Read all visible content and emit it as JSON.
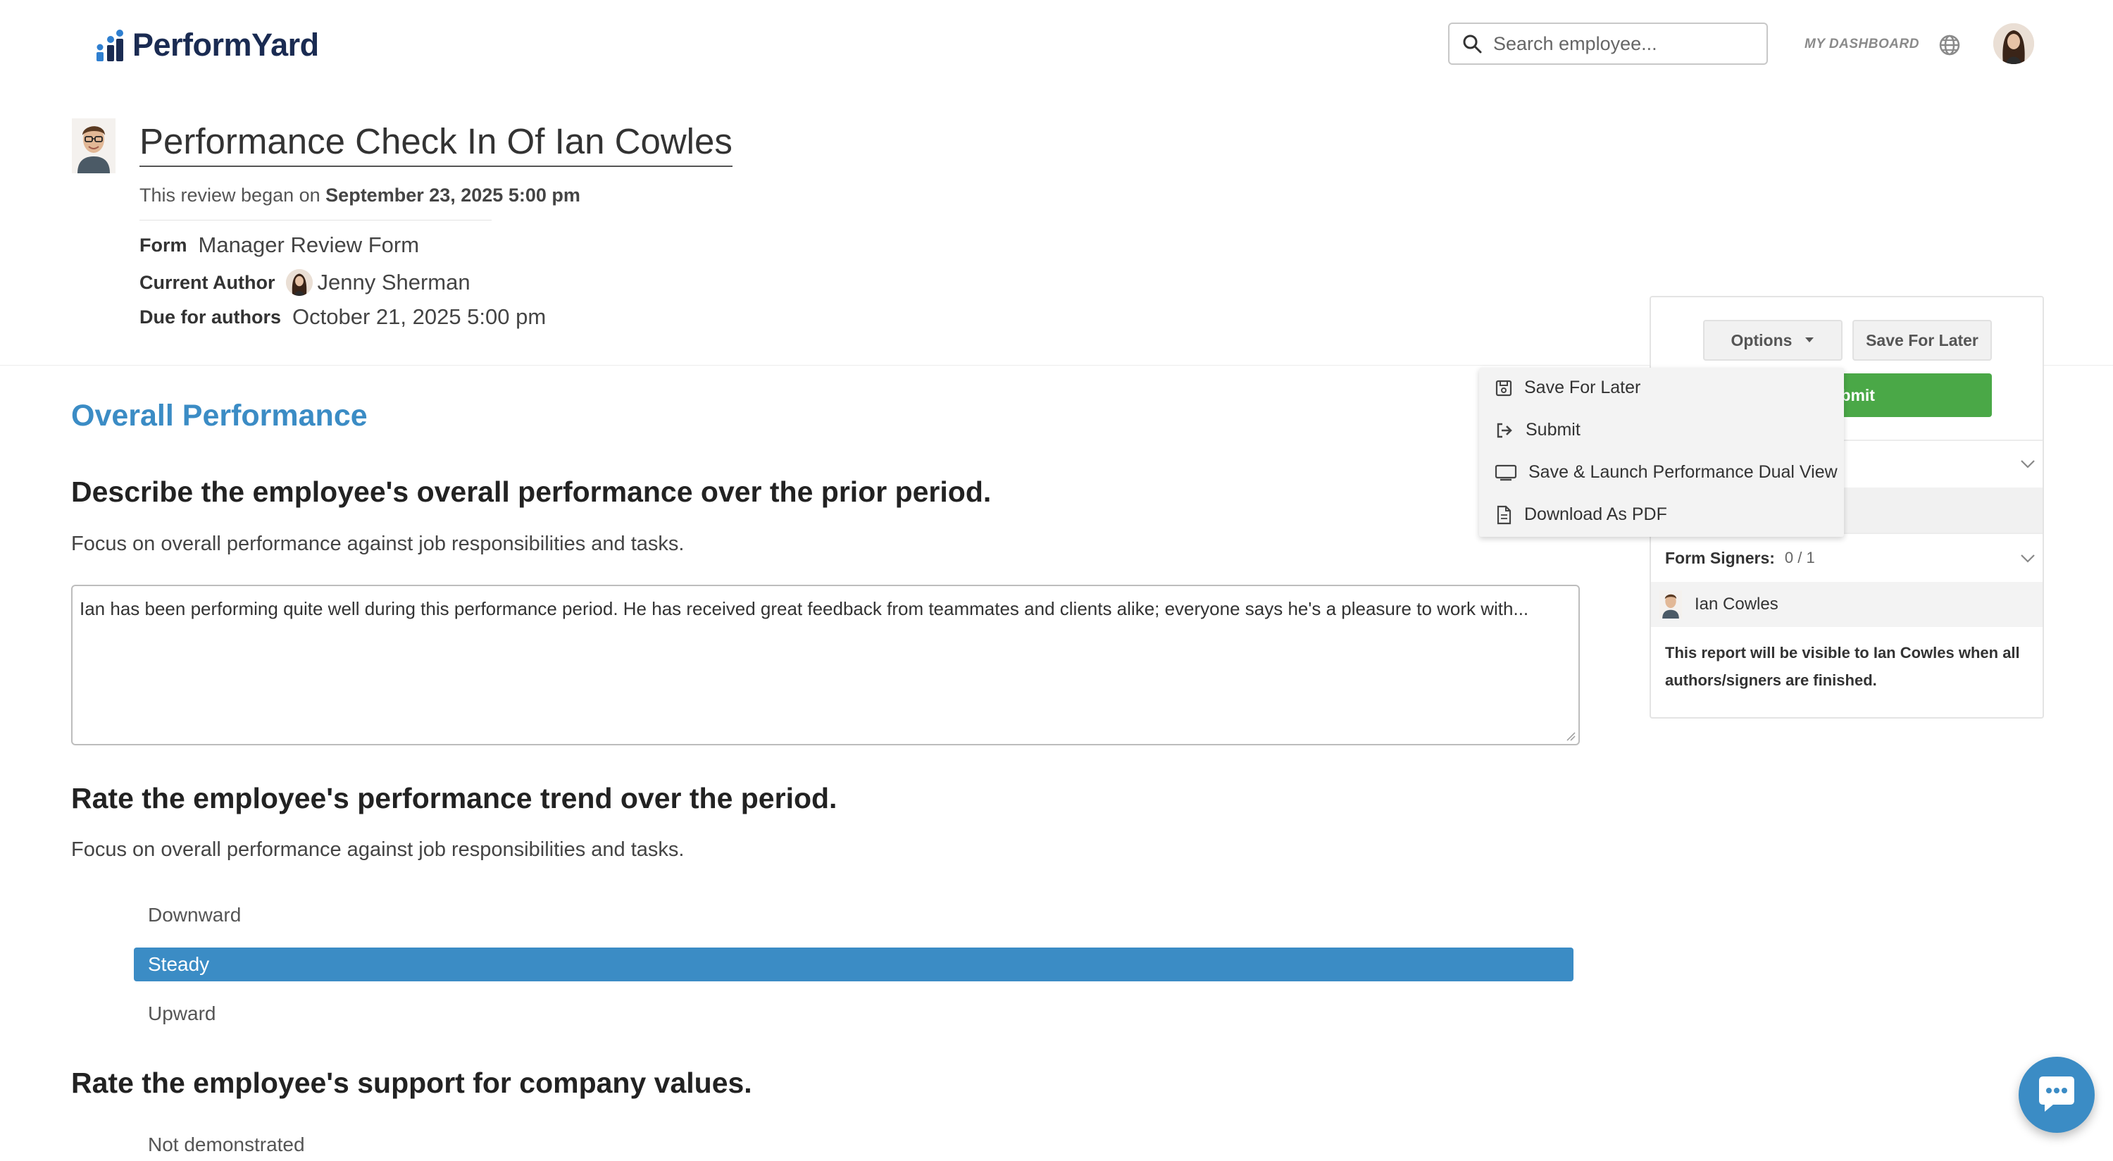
{
  "brand": {
    "name": "PerformYard",
    "color": "#1a2b52"
  },
  "header": {
    "search_placeholder": "Search employee...",
    "dashboard_link": "MY DASHBOARD"
  },
  "review": {
    "title": "Performance Check In Of Ian Cowles",
    "began_prefix": "This review began on",
    "began_date": "September 23, 2025 5:00 pm",
    "form_label": "Form",
    "form_value": "Manager Review Form",
    "author_label": "Current Author",
    "author_value": "Jenny Sherman",
    "due_label": "Due for authors",
    "due_value": "October 21, 2025 5:00 pm"
  },
  "section": {
    "title": "Overall Performance"
  },
  "questions": [
    {
      "title": "Describe the employee's overall performance over the prior period.",
      "hint": "Focus on overall performance against job responsibilities and tasks.",
      "answer": "Ian has been performing quite well during this performance period. He has received great feedback from teammates and clients alike; everyone says he's a pleasure to work with..."
    },
    {
      "title": "Rate the employee's performance trend over the period.",
      "hint": "Focus on overall performance against job responsibilities and tasks.",
      "options": [
        "Downward",
        "Steady",
        "Upward"
      ],
      "selected": "Steady"
    },
    {
      "title": "Rate the employee's support for company values.",
      "options": [
        "Not demonstrated"
      ]
    }
  ],
  "panel": {
    "options_label": "Options",
    "save_label": "Save For Later",
    "submit_label": "Submit",
    "signers_label": "Form Signers:",
    "signers_count": "0 / 1",
    "signer_name": "Ian Cowles",
    "notice": "This report will be visible to Ian Cowles when all authors/signers are finished."
  },
  "dropdown": {
    "items": [
      {
        "label": "Save For Later",
        "icon": "floppy-disk-icon"
      },
      {
        "label": "Submit",
        "icon": "sign-out-icon"
      },
      {
        "label": "Save & Launch Performance Dual View",
        "icon": "monitor-icon"
      },
      {
        "label": "Download As PDF",
        "icon": "document-icon"
      }
    ]
  },
  "colors": {
    "accent": "#3b8cc5",
    "submit_green": "#4aa847"
  }
}
